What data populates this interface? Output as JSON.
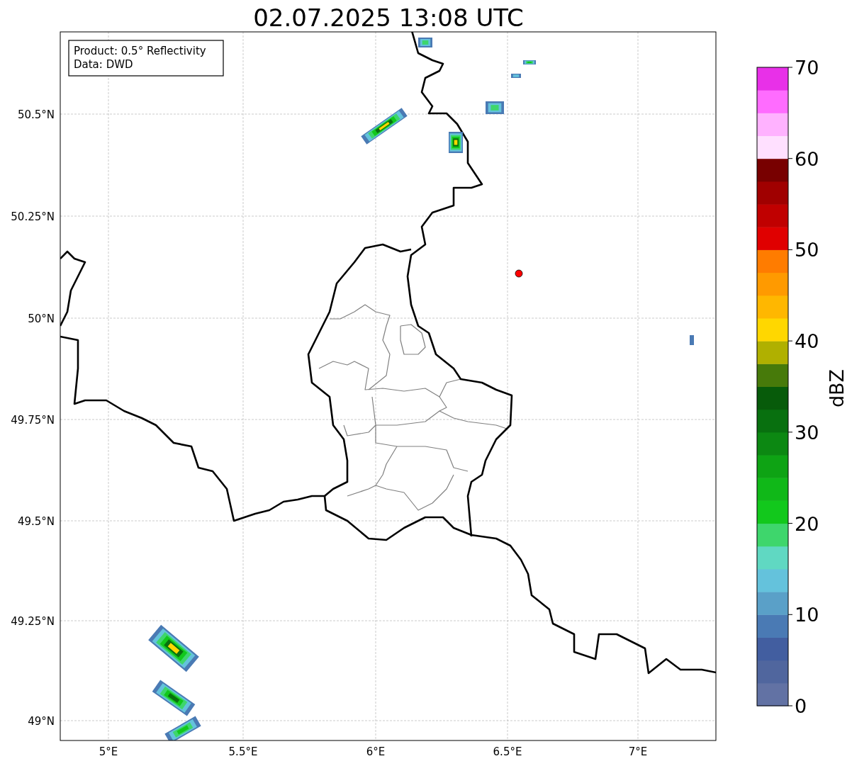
{
  "title": "02.07.2025 13:08 UTC",
  "info_box": {
    "lines": [
      "Product: 0.5° Reflectivity",
      "Data: DWD"
    ]
  },
  "map": {
    "x_ticks": [
      "5°E",
      "5.5°E",
      "6°E",
      "6.5°E",
      "7°E"
    ],
    "y_ticks": [
      "50.5°N",
      "50.25°N",
      "50°N",
      "49.75°N",
      "49.5°N",
      "49.25°N",
      "49°N"
    ]
  },
  "colorbar": {
    "label": "dBZ",
    "ticks": [
      "70",
      "60",
      "50",
      "40",
      "30",
      "20",
      "10",
      "0"
    ],
    "segments": [
      {
        "color": "#6272a4"
      },
      {
        "color": "#50669e"
      },
      {
        "color": "#425ea0"
      },
      {
        "color": "#4a7ab4"
      },
      {
        "color": "#5aa0c8"
      },
      {
        "color": "#64c2dc"
      },
      {
        "color": "#60d8c2"
      },
      {
        "color": "#3ed66c"
      },
      {
        "color": "#12c81c"
      },
      {
        "color": "#10b818"
      },
      {
        "color": "#0ea314"
      },
      {
        "color": "#0c8812"
      },
      {
        "color": "#08700f"
      },
      {
        "color": "#075b0a"
      },
      {
        "color": "#477a0a"
      },
      {
        "color": "#b0b000"
      },
      {
        "color": "#ffd700"
      },
      {
        "color": "#ffb700"
      },
      {
        "color": "#ff9a00"
      },
      {
        "color": "#ff7c00"
      },
      {
        "color": "#e00000"
      },
      {
        "color": "#c00000"
      },
      {
        "color": "#a00000"
      },
      {
        "color": "#780000"
      },
      {
        "color": "#ffe0ff"
      },
      {
        "color": "#ffb2ff"
      },
      {
        "color": "#ff6cff"
      },
      {
        "color": "#e830e8"
      }
    ]
  }
}
